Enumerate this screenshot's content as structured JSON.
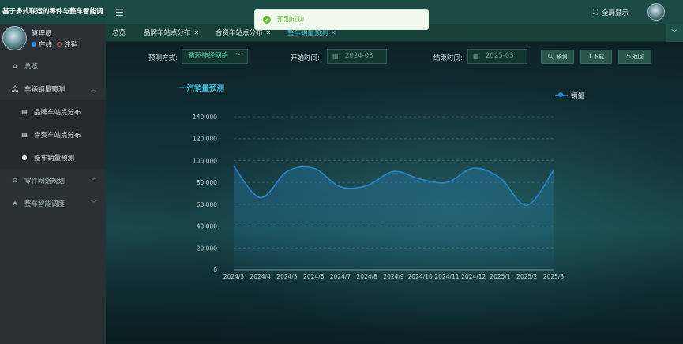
{
  "sidebar": {
    "brand": "基于多式联运的零件与整车智能调",
    "user": {
      "name": "管理员",
      "online": "在线",
      "logout": "注销"
    },
    "items": [
      {
        "label": "总览",
        "icon": "home-icon"
      },
      {
        "label": "车辆销量预测",
        "icon": "bell-icon"
      },
      {
        "label": "品牌车站点分布",
        "icon": "table-icon"
      },
      {
        "label": "合资车站点分布",
        "icon": "table-icon"
      },
      {
        "label": "整车销量预测",
        "icon": "user-icon"
      },
      {
        "label": "零件网络规划",
        "icon": "scale-icon"
      },
      {
        "label": "整车智能调度",
        "icon": "star-icon"
      }
    ]
  },
  "topbar": {
    "fullscreen": "全屏显示"
  },
  "tabs": [
    {
      "label": "总览",
      "closable": false
    },
    {
      "label": "品牌车站点分布",
      "closable": true
    },
    {
      "label": "合资车站点分布",
      "closable": true
    },
    {
      "label": "整车销量预测",
      "closable": true
    }
  ],
  "toast": {
    "message": "预测成功"
  },
  "filters": {
    "method_label": "预测方式:",
    "method_value": "循环神经网络",
    "start_label": "开始时间:",
    "start_value": "2024-03",
    "end_label": "结束时间:",
    "end_value": "2025-03",
    "predict_button": "预测",
    "download_button": "下载",
    "back_button": "返回"
  },
  "colors": {
    "accent": "#3eb7d6",
    "line": "#2a86c8",
    "success": "#67c23a",
    "topbar": "#1c4a44",
    "sidebar": "#2a3136"
  },
  "chart_data": {
    "type": "line",
    "title": "一汽销量预测",
    "legend_position": "top-right",
    "categories": [
      "2024/3",
      "2024/4",
      "2024/5",
      "2024/6",
      "2024/7",
      "2024/8",
      "2024/9",
      "2024/10",
      "2024/11",
      "2024/12",
      "2025/1",
      "2025/2",
      "2025/3"
    ],
    "series": [
      {
        "name": "销量",
        "values": [
          95000,
          66000,
          90000,
          93000,
          76000,
          77000,
          90000,
          83000,
          80000,
          93000,
          84000,
          59000,
          91000
        ]
      }
    ],
    "ylim": [
      0,
      140000
    ],
    "yticks": [
      "0",
      "20,000",
      "40,000",
      "60,000",
      "80,000",
      "100,000",
      "120,000",
      "140,000"
    ],
    "grid": true
  }
}
